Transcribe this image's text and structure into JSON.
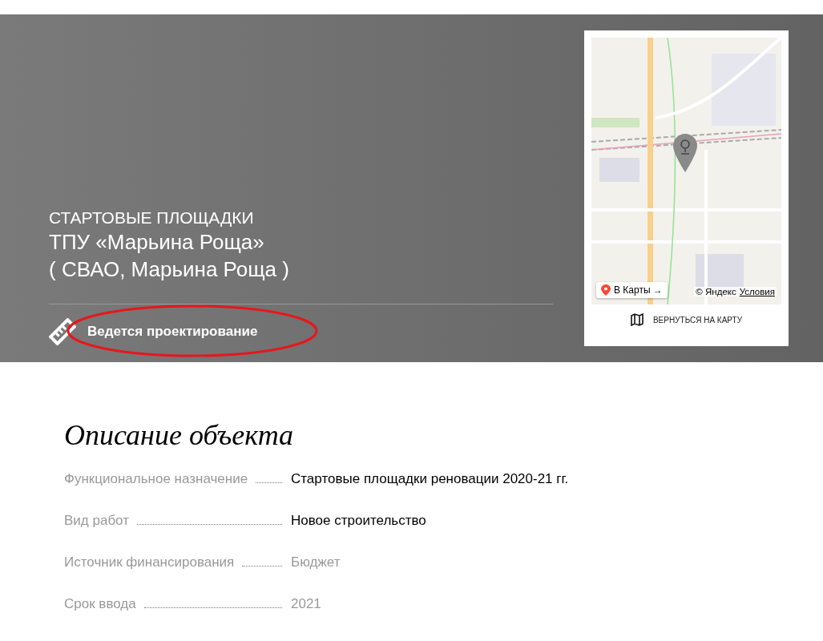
{
  "hero": {
    "category": "СТАРТОВЫЕ ПЛОЩАДКИ",
    "title": "ТПУ «Марьина Роща»",
    "district": "( СВАО, Марьина Роща )",
    "status": "Ведется проектирование"
  },
  "map": {
    "open_link": "В Карты →",
    "copyright": "© Яндекс",
    "terms_link": "Условия",
    "back_button": "ВЕРНУТЬСЯ НА КАРТУ"
  },
  "description": {
    "heading": "Описание объекта",
    "rows": [
      {
        "label": "Функциональное назначение",
        "value": "Стартовые площадки реновации 2020-21 гг.",
        "muted": false
      },
      {
        "label": "Вид работ",
        "value": "Новое строительство",
        "muted": false
      },
      {
        "label": "Источник финансирования",
        "value": "Бюджет",
        "muted": true
      },
      {
        "label": "Срок ввода",
        "value": "2021",
        "muted": true
      }
    ]
  }
}
